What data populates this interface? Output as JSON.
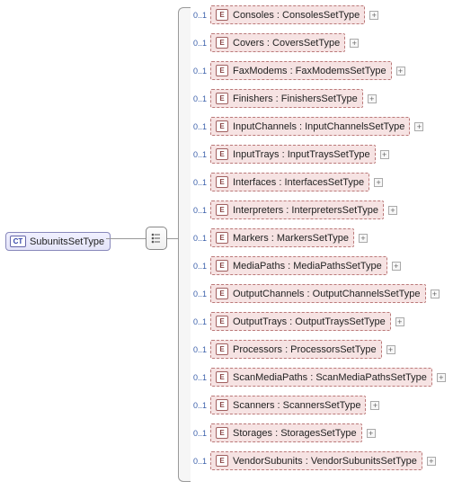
{
  "root": {
    "badge": "CT",
    "label": "SubunitsSetType"
  },
  "occurrence_label": "0..1",
  "element_badge": "E",
  "expand_glyph": "+",
  "children": [
    {
      "name": "Consoles",
      "type": "ConsolesSetType"
    },
    {
      "name": "Covers ",
      "type": "CoversSetType"
    },
    {
      "name": "FaxModems",
      "type": "FaxModemsSetType"
    },
    {
      "name": "Finishers",
      "type": "FinishersSetType"
    },
    {
      "name": "InputChannels",
      "type": "InputChannelsSetType"
    },
    {
      "name": "InputTrays",
      "type": "InputTraysSetType"
    },
    {
      "name": "Interfaces",
      "type": "InterfacesSetType"
    },
    {
      "name": "Interpreters",
      "type": "InterpretersSetType"
    },
    {
      "name": "Markers ",
      "type": "MarkersSetType"
    },
    {
      "name": "MediaPaths",
      "type": "MediaPathsSetType"
    },
    {
      "name": "OutputChannels",
      "type": "OutputChannelsSetType"
    },
    {
      "name": "OutputTrays",
      "type": "OutputTraysSetType"
    },
    {
      "name": "Processors",
      "type": "ProcessorsSetType"
    },
    {
      "name": "ScanMediaPaths",
      "type": "ScanMediaPathsSetType"
    },
    {
      "name": "Scanners",
      "type": "ScannersSetType"
    },
    {
      "name": "Storages",
      "type": "StoragesSetType"
    },
    {
      "name": "VendorSubunits",
      "type": "VendorSubunitsSetType"
    }
  ]
}
